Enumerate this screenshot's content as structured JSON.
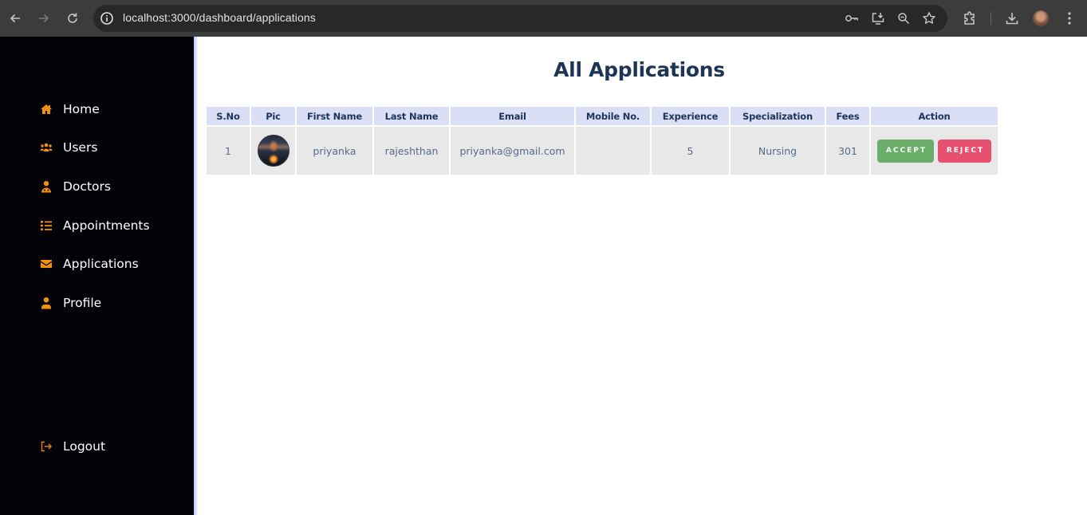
{
  "browser": {
    "url": "localhost:3000/dashboard/applications",
    "nav_icons": [
      "back-arrow-icon",
      "forward-arrow-icon",
      "reload-icon"
    ],
    "omnibox_icons": [
      "password-key-icon",
      "install-app-icon",
      "zoom-icon",
      "bookmark-star-icon"
    ],
    "toolbar_icons": [
      "extensions-icon",
      "download-icon",
      "profile-avatar",
      "menu-kebab-icon"
    ]
  },
  "colors": {
    "sidebar_bg": "#030308",
    "accent_orange": "#f0900f",
    "title_navy": "#1d3557",
    "header_bg": "#dadff5",
    "row_bg": "#e8e8e8",
    "accept_green": "#6aae6a",
    "reject_red": "#e8506f"
  },
  "sidebar": {
    "items": [
      {
        "label": "Home",
        "icon": "home-icon"
      },
      {
        "label": "Users",
        "icon": "users-icon"
      },
      {
        "label": "Doctors",
        "icon": "doctor-icon"
      },
      {
        "label": "Appointments",
        "icon": "list-icon"
      },
      {
        "label": "Applications",
        "icon": "envelope-icon"
      },
      {
        "label": "Profile",
        "icon": "user-icon"
      }
    ],
    "logout": {
      "label": "Logout",
      "icon": "logout-icon"
    }
  },
  "main": {
    "title": "All Applications",
    "table": {
      "columns": [
        "S.No",
        "Pic",
        "First Name",
        "Last Name",
        "Email",
        "Mobile No.",
        "Experience",
        "Specialization",
        "Fees",
        "Action"
      ],
      "rows": [
        {
          "sno": "1",
          "pic": "profile-picture",
          "first_name": "priyanka",
          "last_name": "rajeshthan",
          "email": "priyanka@gmail.com",
          "mobile": "",
          "experience": "5",
          "specialization": "Nursing",
          "fees": "301",
          "actions": {
            "accept": "ACCEPT",
            "reject": "REJECT"
          }
        }
      ]
    }
  }
}
